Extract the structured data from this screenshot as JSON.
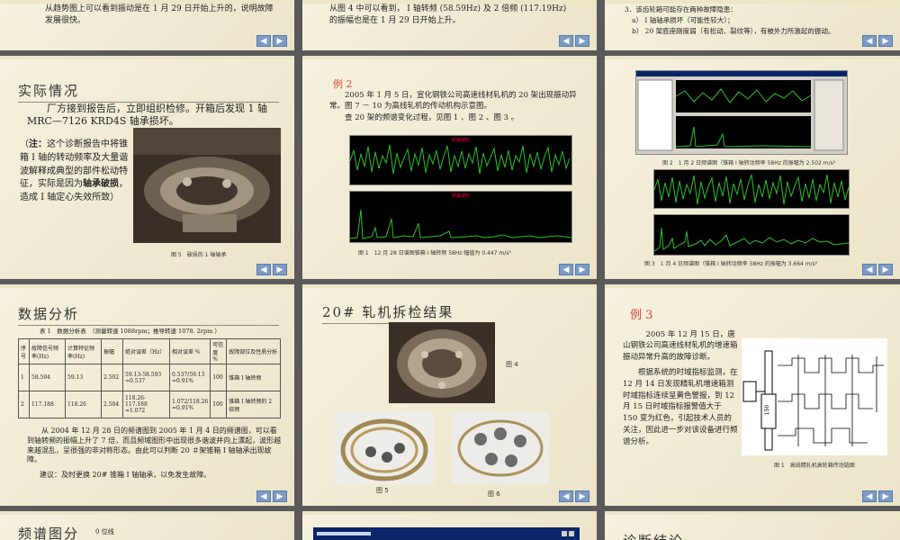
{
  "s1": {
    "text": "从趋势图上可以看到振动是在 1 月 29 日开始上升的，说明故障发展很快。"
  },
  "s2": {
    "text": "从图 4 中可以看到， Ⅰ 轴转频 (58.59Hz) 及 2 倍频 (117.19Hz) 的振幅也是在 1 月 29 日开始上升。"
  },
  "s3": {
    "l1": "3．该齿轮箱可能存在两种故障隐患：",
    "l2": "a） Ⅰ 轴轴承损坏（可能性较大）；",
    "l3": "b） 20 架底座刚度弱（有松动、裂纹等），有被外力所激起的振动。"
  },
  "s4": {
    "title": "实际情况",
    "p1": "厂方接到报告后，立即组织检修。开箱后发现 1 轴 MRC—7126 KRD4S 轴承损坏。",
    "note_a": "（",
    "note_b": "注：",
    "note_c": "这个诊断报告中将锥箱 Ⅰ 轴的转动频率及大量谐波解释成典型的部件松动特征，实际是因为",
    "note_d": "轴承破损",
    "note_e": "，造成 Ⅰ 轴定心失效所致）",
    "caption": "图 5　破损的 1 轴轴承"
  },
  "s5": {
    "label": "例 2",
    "p1": "2005 年 1 月 5 日，宣化钢铁公司高速线材轧机的 20 架出现振动异常。图 7 － 10 为高线轧机的传动机构示意图。",
    "p2": "查 20 架的频谱变化过程，见图 1 、图 2 、图 3 。",
    "chart1_title": "时域波形",
    "chart2_title": "频域波形",
    "caption": "图 1　12 月 28 日谱图锥箱 I 轴转频 58Hz 幅值为 0.447 m/s²"
  },
  "s6": {
    "caption1": "图 2　1 月 2 日频谱图（锥箱 Ⅰ 轴转动频率 58Hz 的振幅为 2.502 m/s²",
    "caption2": "图 3　1 月 4 日频谱图（锥箱 Ⅰ 轴转动频率 58Hz 的振幅为 3.664 m/s²"
  },
  "s7": {
    "title": "数据分析",
    "table_caption": "表 1　数据分析表　（测量转速 1088rpm；推导转速 1078. 2rpm ）",
    "headers": [
      "序号",
      "故障信号频率(Hz)",
      "计算特征频率(Hz)",
      "振幅",
      "绝对误差（Hz）",
      "相对误差 %",
      "可信度 %",
      "故障部位及性质分析"
    ],
    "rows": [
      [
        "1",
        "58.594",
        "59.13",
        "2.502",
        "59.13-58.593 =0.537",
        "0.537/59.13 =0.91%",
        "100",
        "锥箱 Ⅰ 轴转频"
      ],
      [
        "2",
        "117.188",
        "118.26",
        "2.504",
        "118.26-117.188 =1.072",
        "1.072/118.26 =0.91%",
        "100",
        "锥箱 Ⅰ 轴转频的 2 倍频"
      ]
    ],
    "p1": "从 2004 年 12 月 28 日的频谱图到 2005 年 1 月 4 日的频谱图，可以看到轴转频的振幅上升了 7 倍，而且频域图形中出现很多谐波并向上漂起，波形越来越混乱，呈很强的非对称形态。由此可以判断 20 ＃架锥箱 Ⅰ 轴轴承出现故障。",
    "p2": "建议：及时更换 20# 锥箱 Ⅰ 轴轴承，以免发生故障。"
  },
  "s8": {
    "title": "20# 轧机拆检结果",
    "fig4": "图 4",
    "fig5": "图 5",
    "fig6": "图 6"
  },
  "s9": {
    "label": "例 3",
    "p1": "2005 年 12 月 15 日，唐山钢铁公司高速线材轧机的增速箱振动异常升高的故障诊断。",
    "p2": "根据系统的时域指标监测，在 12 月 14 日发现精轧机增速箱测时域指标连续呈黄色警报，到 12 月 15 日时域指标报警值大于 150 变为红色，引起技术人员的关注，因此进一步对该设备进行频谱分析。",
    "caption": "图 1　高线精轧机高轮箱传动链图",
    "box_label": "150"
  },
  "s10": {
    "title": "频谱图分析",
    "sub": "0 位线"
  },
  "s12": {
    "title": "诊断结论"
  },
  "nav": {
    "prev": "◀",
    "next": "▶"
  },
  "colors": {
    "accent": "#d9453a",
    "nav": "#7d9bc6",
    "slide_bg": "#f3eed8"
  }
}
